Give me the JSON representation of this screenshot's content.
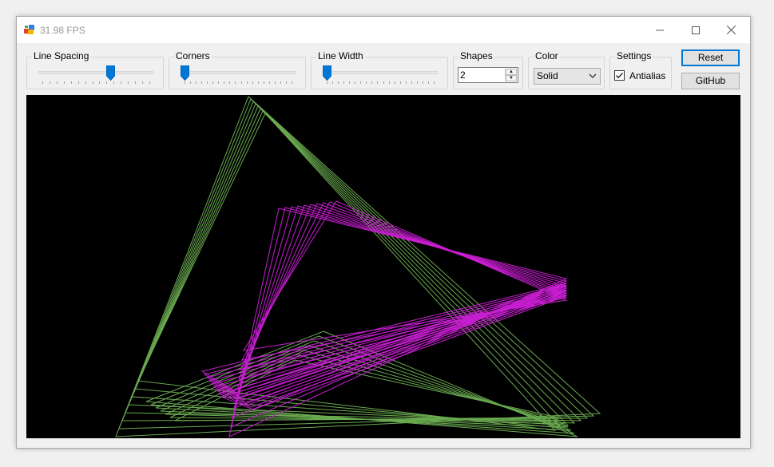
{
  "window": {
    "title": "31.98 FPS"
  },
  "icons": {
    "app": "app-icon",
    "minimize": "minimize-icon",
    "maximize": "maximize-icon",
    "close": "close-icon"
  },
  "controls": {
    "line_spacing": {
      "label": "Line Spacing",
      "ticks": 16,
      "value": 0.64
    },
    "corners": {
      "label": "Corners",
      "ticks": 20,
      "value": 0.0
    },
    "line_width": {
      "label": "Line Width",
      "ticks": 20,
      "value": 0.0
    },
    "shapes": {
      "label": "Shapes",
      "value": "2"
    },
    "color": {
      "label": "Color",
      "selected": "Solid"
    },
    "settings": {
      "label": "Settings",
      "antialias_label": "Antialias",
      "antialias_checked": true
    },
    "reset_label": "Reset",
    "github_label": "GitHub"
  },
  "colors": {
    "accent": "#0078d7",
    "canvas_bg": "#000000",
    "shape1": "#6aaa50",
    "shape2": "#c81ed2"
  }
}
